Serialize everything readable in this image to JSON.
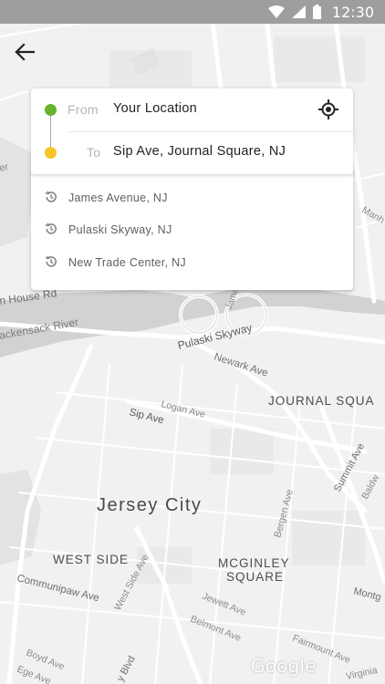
{
  "status_bar": {
    "time": "12:30",
    "icons": [
      "wifi-icon",
      "cellular-signal-icon",
      "battery-icon"
    ]
  },
  "navigation": {
    "back_icon": "arrow-left-icon"
  },
  "route": {
    "from": {
      "label": "From",
      "value": "Your Location",
      "dot_color": "#66b32e"
    },
    "to": {
      "label": "To",
      "value": "Sip Ave, Journal Square, NJ",
      "dot_color": "#f5c42c"
    },
    "locate_icon": "gps-target-icon"
  },
  "history": [
    {
      "label": "James Avenue, NJ",
      "icon": "history-icon"
    },
    {
      "label": "Pulaski Skyway, NJ",
      "icon": "history-icon"
    },
    {
      "label": "New Trade Center, NJ",
      "icon": "history-icon"
    }
  ],
  "map": {
    "labels": {
      "hn_rd": "n House Rd",
      "hack_river": "ackensack River",
      "pulaski": "Pulaski Skyway",
      "newark": "Newark Ave",
      "sip": "Sip Ave",
      "logan": "Logan Ave",
      "journal": "JOURNAL SQUA",
      "summit": "Summit Ave",
      "baldw": "Baldw",
      "jersey": "Jersey City",
      "bergen": "Bergen Ave",
      "westside": "WEST SIDE",
      "mcginley1": "MCGINLEY",
      "mcginley2": "SQUARE",
      "westside_ave": "West Side Ave",
      "communipaw": "Communipaw Ave",
      "jewett": "Jewett Ave",
      "belmont": "Belmont Ave",
      "montg": "Montg",
      "fairmount": "Fairmount Ave",
      "boyd": "Boyd Ave",
      "ege": "Ege Ave",
      "kennedy": "y Blvd",
      "virginia": "Virginia",
      "james": "James",
      "manh": "Manh",
      "er": "er"
    },
    "logo": "Google"
  }
}
